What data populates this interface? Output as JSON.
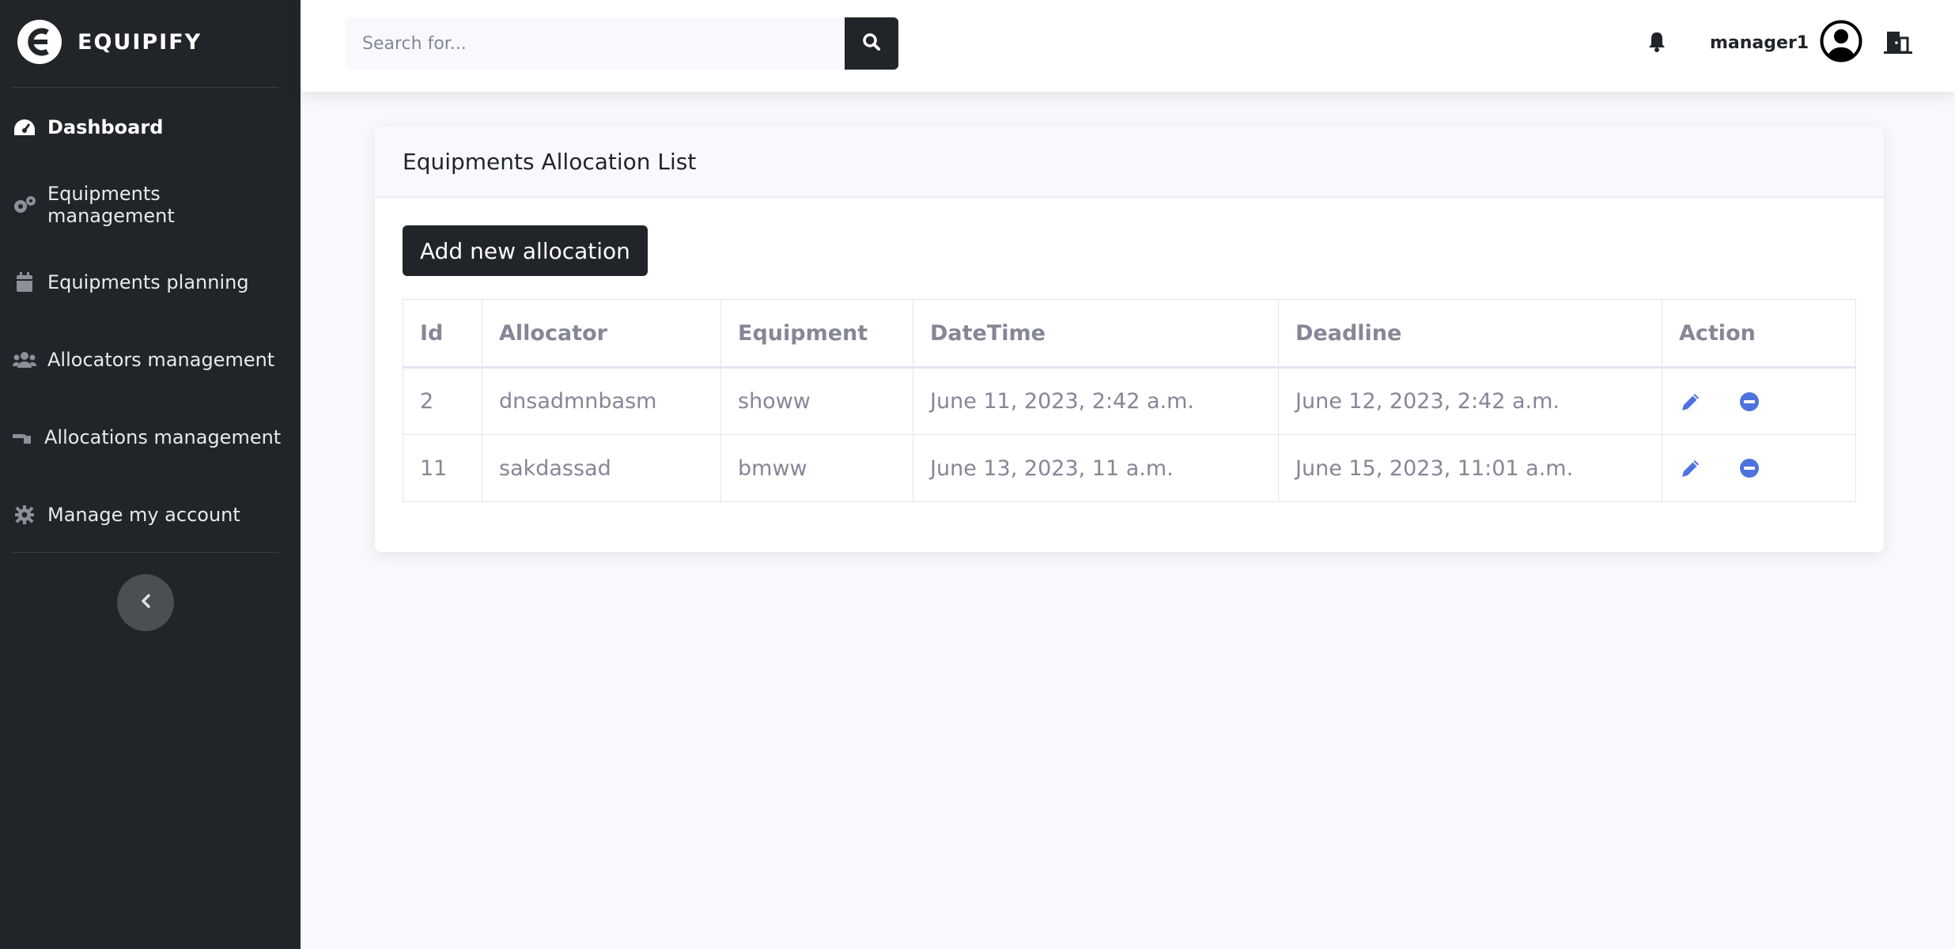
{
  "brand": {
    "name": "EQUIPIFY"
  },
  "sidebar": {
    "items": [
      {
        "label": "Dashboard",
        "icon": "gauge-icon"
      },
      {
        "label": "Equipments management",
        "icon": "gears-icon"
      },
      {
        "label": "Equipments planning",
        "icon": "calendar-icon"
      },
      {
        "label": "Allocators management",
        "icon": "users-icon"
      },
      {
        "label": "Allocations management",
        "icon": "hand-holding-icon"
      },
      {
        "label": "Manage my account",
        "icon": "gear-icon"
      }
    ],
    "collapse_icon": "chevron-left-icon"
  },
  "topbar": {
    "search_placeholder": "Search for...",
    "username": "manager1"
  },
  "card": {
    "title": "Equipments Allocation List",
    "add_button": "Add new allocation",
    "columns": [
      "Id",
      "Allocator",
      "Equipment",
      "DateTime",
      "Deadline",
      "Action"
    ],
    "rows": [
      {
        "id": "2",
        "allocator": "dnsadmnbasm",
        "equipment": "showw",
        "datetime": "June 11, 2023, 2:42 a.m.",
        "deadline": "June 12, 2023, 2:42 a.m."
      },
      {
        "id": "11",
        "allocator": "sakdassad",
        "equipment": "bmww",
        "datetime": "June 13, 2023, 11 a.m.",
        "deadline": "June 15, 2023, 11:01 a.m."
      }
    ]
  },
  "colors": {
    "sidebar_bg": "#212529",
    "accent": "#4e73df",
    "page_bg": "#f8f9fc"
  }
}
